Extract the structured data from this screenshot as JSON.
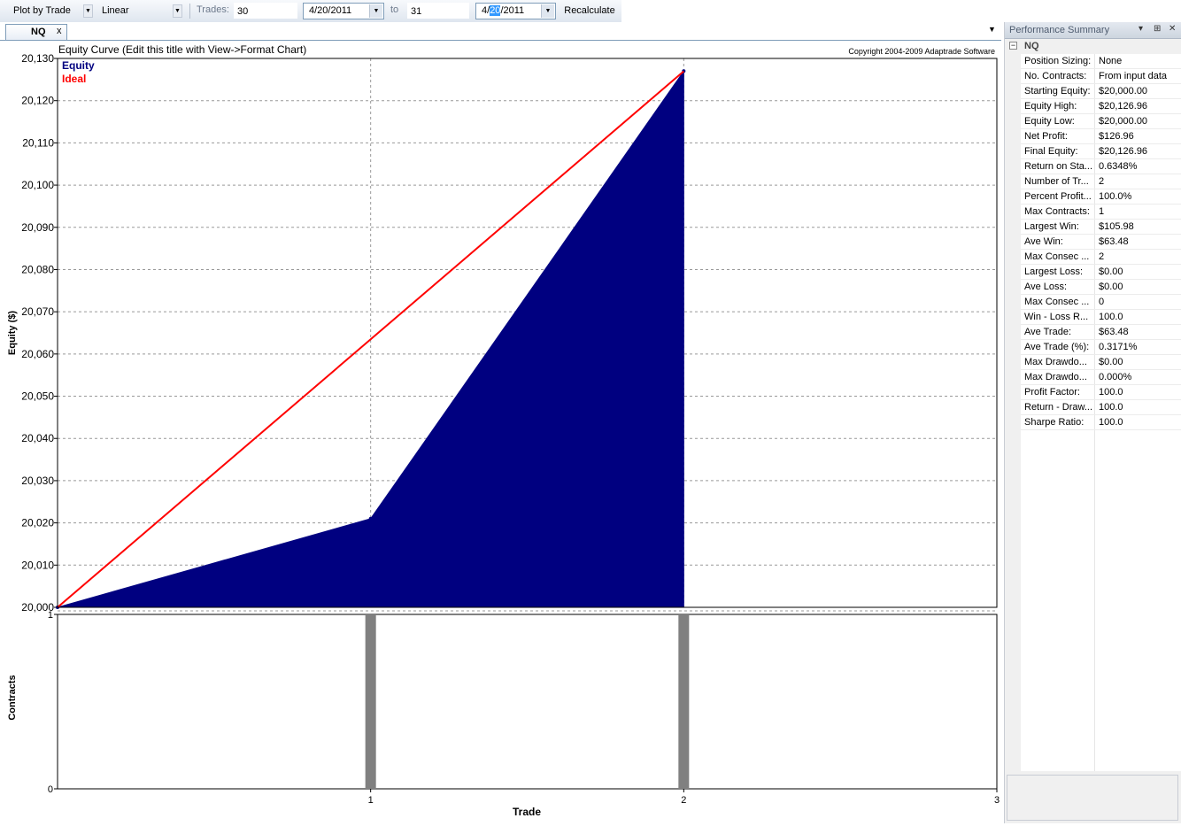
{
  "toolbar": {
    "plot_mode": "Plot by Trade",
    "scale": "Linear",
    "trades_label": "Trades:",
    "trades_from": "30",
    "date_from": "4/20/2011",
    "to_label": "to",
    "trades_to": "31",
    "date_to_pre": "4/",
    "date_to_sel": "20",
    "date_to_post": "/2011",
    "recalculate": "Recalculate"
  },
  "document": {
    "tab_label": "NQ",
    "close_glyph": "x",
    "menu_glyph": "▼"
  },
  "chart_data": [
    {
      "type": "area",
      "title": "Equity Curve (Edit this title with View->Format Chart)",
      "copyright": "Copyright 2004-2009 Adaptrade Software",
      "ylabel": "Equity ($)",
      "ylim": [
        20000,
        20130
      ],
      "y_ticks": [
        "20,000",
        "20,010",
        "20,020",
        "20,030",
        "20,040",
        "20,050",
        "20,060",
        "20,070",
        "20,080",
        "20,090",
        "20,100",
        "20,110",
        "20,120",
        "20,130"
      ],
      "x": [
        0,
        1,
        2
      ],
      "xlim": [
        0,
        3
      ],
      "grid": true,
      "legend_position": "top-left",
      "series": [
        {
          "name": "Equity",
          "values": [
            20000,
            20021,
            20127
          ],
          "color": "#000080"
        },
        {
          "name": "Ideal",
          "values": [
            20000,
            20063.48,
            20126.96
          ],
          "color": "#ff0000"
        }
      ]
    },
    {
      "type": "bar",
      "ylabel": "Contracts",
      "xlabel": "Trade",
      "x": [
        1,
        2
      ],
      "values": [
        1,
        1
      ],
      "ylim": [
        0,
        1
      ],
      "y_ticks": [
        "0",
        "1"
      ],
      "x_ticks": [
        "1",
        "2",
        "3"
      ],
      "color": "#808080"
    }
  ],
  "panel": {
    "title": "Performance Summary",
    "pin_glyph": "▾",
    "float_glyph": "⊞",
    "close_glyph": "✕",
    "group": "NQ",
    "expander": "−",
    "rows": [
      {
        "key": "Position Sizing:",
        "value": "None"
      },
      {
        "key": "No. Contracts:",
        "value": "From input data"
      },
      {
        "key": "Starting Equity:",
        "value": "$20,000.00"
      },
      {
        "key": "Equity High:",
        "value": "$20,126.96"
      },
      {
        "key": "Equity Low:",
        "value": "$20,000.00"
      },
      {
        "key": "Net Profit:",
        "value": "$126.96"
      },
      {
        "key": "Final Equity:",
        "value": "$20,126.96"
      },
      {
        "key": "Return on Sta...",
        "value": "0.6348%"
      },
      {
        "key": "Number of Tr...",
        "value": "2"
      },
      {
        "key": "Percent Profit...",
        "value": "100.0%"
      },
      {
        "key": "Max Contracts:",
        "value": "1"
      },
      {
        "key": "Largest Win:",
        "value": "$105.98"
      },
      {
        "key": "Ave Win:",
        "value": "$63.48"
      },
      {
        "key": "Max Consec ...",
        "value": "2"
      },
      {
        "key": "Largest Loss:",
        "value": "$0.00"
      },
      {
        "key": "Ave Loss:",
        "value": "$0.00"
      },
      {
        "key": "Max Consec ...",
        "value": "0"
      },
      {
        "key": "Win - Loss R...",
        "value": "100.0"
      },
      {
        "key": "Ave Trade:",
        "value": "$63.48"
      },
      {
        "key": "Ave Trade (%):",
        "value": "0.3171%"
      },
      {
        "key": "Max Drawdo...",
        "value": "$0.00"
      },
      {
        "key": "Max Drawdo...",
        "value": "0.000%"
      },
      {
        "key": "Profit Factor:",
        "value": "100.0"
      },
      {
        "key": "Return - Draw...",
        "value": "100.0"
      },
      {
        "key": "Sharpe Ratio:",
        "value": "100.0"
      }
    ]
  }
}
